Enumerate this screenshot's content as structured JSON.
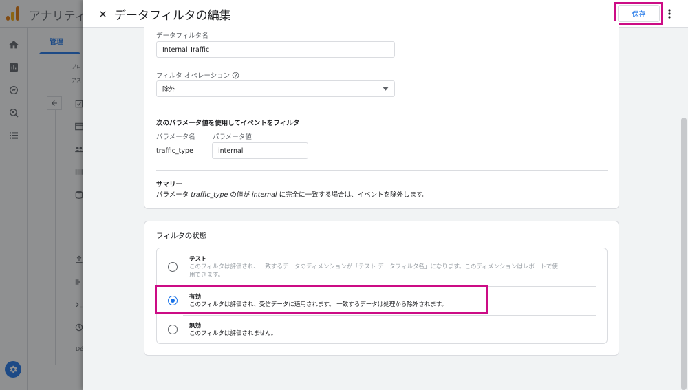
{
  "app": {
    "title": "アナリティ",
    "admin_tab": "管理",
    "sub_lines": [
      "プロ",
      "アス"
    ],
    "nav_short_label": "Dé"
  },
  "drawer": {
    "title": "データフィルタの編集",
    "save_label": "保存"
  },
  "filter_card": {
    "name_label": "データフィルタ名",
    "name_value": "Internal Traffic",
    "operation_label": "フィルタ オペレーション",
    "operation_value": "除外",
    "param_heading": "次のパラメータ値を使用してイベントをフィルタ",
    "param_name_label": "パラメータ名",
    "param_value_label": "パラメータ値",
    "param_name": "traffic_type",
    "param_value": "internal",
    "summary_heading": "サマリー",
    "summary": {
      "prefix": "パラメータ ",
      "param": "traffic_type",
      "mid": " の値が ",
      "value": "internal",
      "suffix": " に完全に一致する場合は、イベントを除外します。"
    }
  },
  "state_card": {
    "heading": "フィルタの状態",
    "options": [
      {
        "title": "テスト",
        "desc_line1": "このフィルタは評価され、一致するデータのディメンションが「テスト データフィルタ名」になります。このディメンションはレポートで使",
        "desc_line2": "用できます。",
        "selected": false
      },
      {
        "title": "有効",
        "desc_line1": "このフィルタは評価され、受信データに適用されます。 一致するデータは処理から除外されます。",
        "selected": true
      },
      {
        "title": "無効",
        "desc_line1": "このフィルタは評価されません。",
        "selected": false
      }
    ]
  },
  "colors": {
    "accent": "#1a73e8",
    "highlight": "#cc0c85"
  }
}
